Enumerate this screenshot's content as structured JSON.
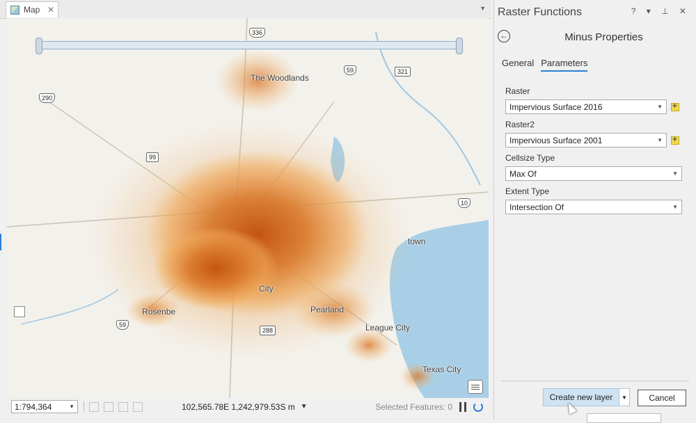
{
  "map_tab": {
    "label": "Map",
    "close": "✕"
  },
  "map": {
    "places": {
      "the_woodlands": "The Woodlands",
      "town": "town",
      "city": "City",
      "rosenberg": "Rosenbe",
      "pearland": "Pearland",
      "league_city": "League City",
      "texas_city": "Texas City"
    },
    "shields": {
      "i45": "336",
      "us59_north": "59",
      "us290": "290",
      "sh99": "99",
      "us59_south": "59",
      "sh288": "288",
      "i10": "10",
      "sh321": "321"
    }
  },
  "statusbar": {
    "scale": "1:794,364",
    "coordinates": "102,565.78E 1,242,979.53S m",
    "selected_features": "Selected Features: 0"
  },
  "pane": {
    "title": "Raster Functions",
    "controls": "? ▾ ⊥ ✕",
    "properties_title": "Minus Properties",
    "tabs": [
      {
        "label": "General",
        "active": false
      },
      {
        "label": "Parameters",
        "active": true
      }
    ],
    "fields": {
      "raster": {
        "label": "Raster",
        "value": "Impervious Surface 2016"
      },
      "raster2": {
        "label": "Raster2",
        "value": "Impervious Surface 2001"
      },
      "cellsize_type": {
        "label": "Cellsize Type",
        "value": "Max Of"
      },
      "extent_type": {
        "label": "Extent Type",
        "value": "Intersection Of"
      }
    },
    "create_button": "Create new layer",
    "cancel_button": "Cancel"
  },
  "colors": {
    "accent": "#2a7fd4",
    "urban_low": "#f4b766",
    "urban_high": "#c2520c",
    "water": "#a9cfe6"
  }
}
